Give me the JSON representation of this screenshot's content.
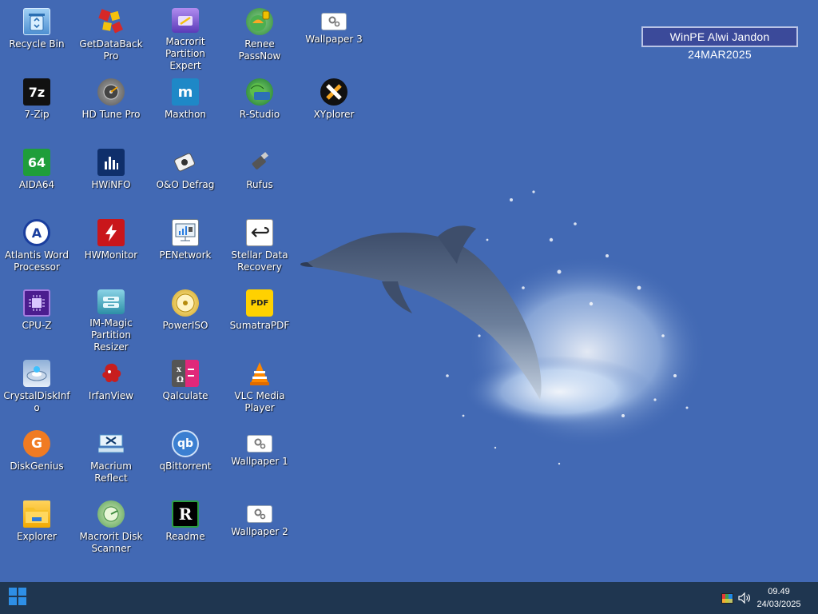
{
  "desktop": {
    "badge_text": "WinPE Alwi Jandon 24MAR2025",
    "icons": [
      {
        "label": "Recycle Bin",
        "icon": "recycle-bin-icon"
      },
      {
        "label": "7-Zip",
        "icon": "7zip-icon",
        "glyph": "7z"
      },
      {
        "label": "AIDA64",
        "icon": "aida64-icon",
        "glyph": "64"
      },
      {
        "label": "Atlantis Word Processor",
        "icon": "atlantis-icon",
        "glyph": "A"
      },
      {
        "label": "CPU-Z",
        "icon": "cpuz-icon"
      },
      {
        "label": "CrystalDiskInfo",
        "icon": "crystaldiskinfo-icon"
      },
      {
        "label": "DiskGenius",
        "icon": "diskgenius-icon",
        "glyph": "G"
      },
      {
        "label": "Explorer",
        "icon": "folder-icon"
      },
      {
        "label": "GetDataBack Pro",
        "icon": "getdataback-icon"
      },
      {
        "label": "HD Tune Pro",
        "icon": "hdtune-icon"
      },
      {
        "label": "HWiNFO",
        "icon": "hwinfo-icon"
      },
      {
        "label": "HWMonitor",
        "icon": "hwmonitor-icon"
      },
      {
        "label": "IM-Magic Partition Resizer",
        "icon": "immagic-icon"
      },
      {
        "label": "IrfanView",
        "icon": "irfanview-icon"
      },
      {
        "label": "Macrium Reflect",
        "icon": "macrium-icon"
      },
      {
        "label": "Macrorit Disk Scanner",
        "icon": "disk-scanner-icon"
      },
      {
        "label": "Macrorit Partition Expert",
        "icon": "partition-expert-icon"
      },
      {
        "label": "Maxthon",
        "icon": "maxthon-icon",
        "glyph": "m"
      },
      {
        "label": "O&O Defrag",
        "icon": "defrag-icon"
      },
      {
        "label": "PENetwork",
        "icon": "penetwork-icon"
      },
      {
        "label": "PowerISO",
        "icon": "poweriso-icon"
      },
      {
        "label": "Qalculate",
        "icon": "qalculate-icon"
      },
      {
        "label": "qBittorrent",
        "icon": "qbittorrent-icon",
        "glyph": "qb"
      },
      {
        "label": "Readme",
        "icon": "readme-icon",
        "glyph": "R"
      },
      {
        "label": "Renee PassNow",
        "icon": "renee-icon"
      },
      {
        "label": "R-Studio",
        "icon": "rstudio-icon"
      },
      {
        "label": "Rufus",
        "icon": "usb-drive-icon"
      },
      {
        "label": "Stellar Data Recovery",
        "icon": "stellar-icon"
      },
      {
        "label": "SumatraPDF",
        "icon": "sumatrapdf-icon",
        "glyph": "PDF"
      },
      {
        "label": "VLC Media Player",
        "icon": "vlc-icon"
      },
      {
        "label": "Wallpaper 1",
        "icon": "settings-gear-icon"
      },
      {
        "label": "Wallpaper 2",
        "icon": "settings-gear-icon"
      },
      {
        "label": "Wallpaper 3",
        "icon": "settings-gear-icon"
      },
      {
        "label": "XYplorer",
        "icon": "xyplorer-icon"
      }
    ]
  },
  "taskbar": {
    "time": "09.49",
    "date": "24/03/2025"
  },
  "colors": {
    "desktop_background": "#4269b4",
    "taskbar": "#1f3650",
    "badge_background": "#3b4a9a"
  }
}
